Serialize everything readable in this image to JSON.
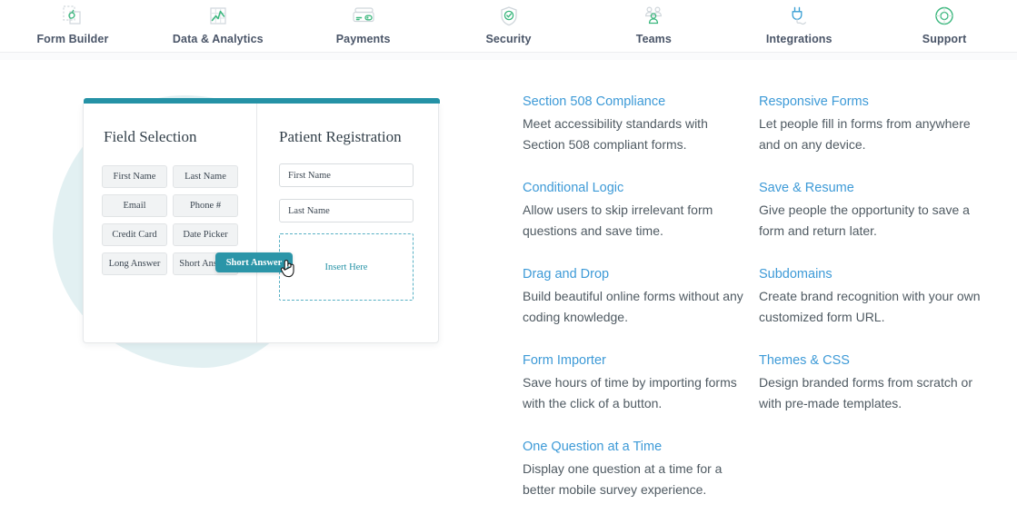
{
  "nav": {
    "items": [
      {
        "label": "Form Builder",
        "icon": "form-builder-icon"
      },
      {
        "label": "Data & Analytics",
        "icon": "chart-grid-icon"
      },
      {
        "label": "Payments",
        "icon": "credit-card-icon"
      },
      {
        "label": "Security",
        "icon": "shield-check-icon"
      },
      {
        "label": "Teams",
        "icon": "people-group-icon"
      },
      {
        "label": "Integrations",
        "icon": "power-plug-icon"
      },
      {
        "label": "Support",
        "icon": "life-ring-icon"
      }
    ]
  },
  "builder": {
    "field_selection_title": "Field Selection",
    "patient_registration_title": "Patient Registration",
    "field_chips": [
      "First Name",
      "Last Name",
      "Email",
      "Phone #",
      "Credit Card",
      "Date Picker",
      "Long Answer",
      "Short Answer"
    ],
    "preview_fields": [
      "First Name",
      "Last Name"
    ],
    "dropzone_label": "Insert Here",
    "drag_chip_label": "Short Answer",
    "accent_color": "#2592a6",
    "dropzone_border_color": "#57b0c4",
    "blob_color": "#e2f0f2"
  },
  "features": {
    "link_color": "#3d9ad7",
    "columns": [
      {
        "items": [
          {
            "title": "Section 508 Compliance",
            "description": "Meet accessibility standards with Section 508 compliant forms."
          },
          {
            "title": "Conditional Logic",
            "description": "Allow users to skip irrelevant form questions and save time."
          },
          {
            "title": "Drag and Drop",
            "description": "Build beautiful online forms without any coding knowledge."
          },
          {
            "title": "Form Importer",
            "description": "Save hours of time by importing forms with the click of a button."
          },
          {
            "title": "One Question at a Time",
            "description": "Display one question at a time for a better mobile survey experience."
          }
        ]
      },
      {
        "items": [
          {
            "title": "Responsive Forms",
            "description": "Let people fill in forms from anywhere and on any device."
          },
          {
            "title": "Save & Resume",
            "description": "Give people the opportunity to save a form and return later."
          },
          {
            "title": "Subdomains",
            "description": "Create brand recognition with your own customized form URL."
          },
          {
            "title": "Themes & CSS",
            "description": "Design branded forms from scratch or with pre-made templates."
          }
        ]
      }
    ]
  }
}
